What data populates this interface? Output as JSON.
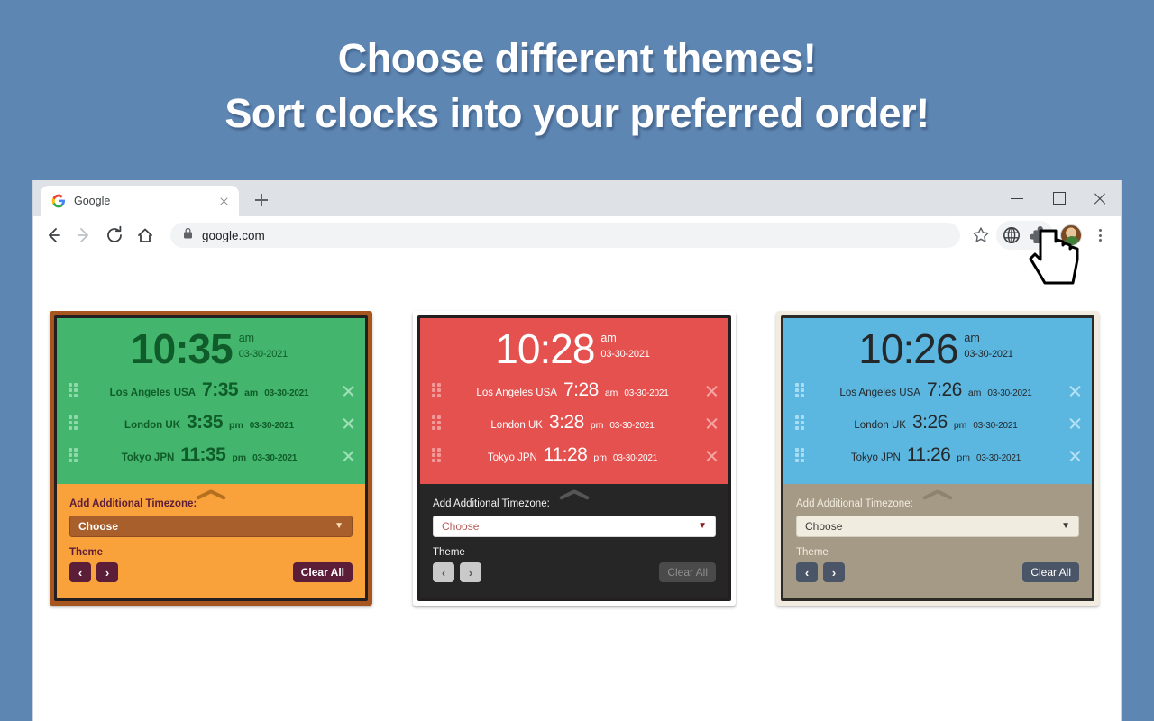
{
  "headline": {
    "line1": "Choose different themes!",
    "line2": "Sort clocks into your preferred order!"
  },
  "colors": {
    "page_background": "#5e86b3",
    "green_theme": "#43b56c",
    "green_settings": "#f9a13a",
    "red_theme": "#e4514e",
    "red_settings": "#262626",
    "blue_theme": "#5bb7e0",
    "blue_settings": "#a59a85"
  },
  "browser": {
    "tab": {
      "title": "Google",
      "favicon": "google-g-icon",
      "close": "close-icon"
    },
    "new_tab": "plus-icon",
    "window_controls": {
      "minimize": "minimize-icon",
      "maximize": "maximize-icon",
      "close": "close-icon"
    },
    "nav": {
      "back": "back-arrow-icon",
      "forward": "forward-arrow-icon",
      "reload": "reload-icon",
      "home": "home-icon"
    },
    "omnibox": {
      "lock": "lock-icon",
      "url": "google.com",
      "bookmark": "star-icon"
    },
    "toolbar_icons": {
      "extension": "globe-icon",
      "extensions_menu": "puzzle-piece-icon",
      "profile": "avatar-icon",
      "menu": "three-dot-menu-icon"
    }
  },
  "common": {
    "add_timezone_label": "Add Additional Timezone:",
    "choose_placeholder": "Choose",
    "theme_label": "Theme",
    "clear_all_label": "Clear All",
    "prev_arrow": "‹",
    "next_arrow": "›",
    "collapse": "chevron-up-icon",
    "date": "03-30-2021"
  },
  "panels": [
    {
      "id": "green",
      "main": {
        "time": "10:35",
        "ampm": "am",
        "date": "03-30-2021"
      },
      "clocks": [
        {
          "city": "Los Angeles USA",
          "time": "7:35",
          "ampm": "am",
          "date": "03-30-2021"
        },
        {
          "city": "London UK",
          "time": "3:35",
          "ampm": "pm",
          "date": "03-30-2021"
        },
        {
          "city": "Tokyo JPN",
          "time": "11:35",
          "ampm": "pm",
          "date": "03-30-2021"
        }
      ]
    },
    {
      "id": "red",
      "main": {
        "time": "10:28",
        "ampm": "am",
        "date": "03-30-2021"
      },
      "clocks": [
        {
          "city": "Los Angeles USA",
          "time": "7:28",
          "ampm": "am",
          "date": "03-30-2021"
        },
        {
          "city": "London UK",
          "time": "3:28",
          "ampm": "pm",
          "date": "03-30-2021"
        },
        {
          "city": "Tokyo JPN",
          "time": "11:28",
          "ampm": "pm",
          "date": "03-30-2021"
        }
      ]
    },
    {
      "id": "blue",
      "main": {
        "time": "10:26",
        "ampm": "am",
        "date": "03-30-2021"
      },
      "clocks": [
        {
          "city": "Los Angeles USA",
          "time": "7:26",
          "ampm": "am",
          "date": "03-30-2021"
        },
        {
          "city": "London UK",
          "time": "3:26",
          "ampm": "pm",
          "date": "03-30-2021"
        },
        {
          "city": "Tokyo JPN",
          "time": "11:26",
          "ampm": "pm",
          "date": "03-30-2021"
        }
      ]
    }
  ]
}
